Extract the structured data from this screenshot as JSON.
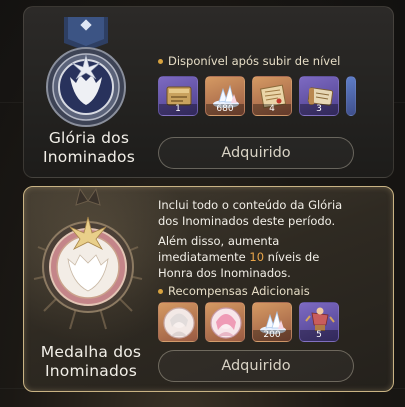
{
  "card1": {
    "name": "Glória dos\nInominados",
    "availability_text": "Disponível após subir de nível",
    "items": [
      {
        "icon": "scroll-box-icon",
        "qty": "1"
      },
      {
        "icon": "crystal-icon",
        "qty": "680"
      },
      {
        "icon": "map-scroll-icon",
        "qty": "4"
      },
      {
        "icon": "book-scroll-icon",
        "qty": "3"
      }
    ],
    "button_label": "Adquirido"
  },
  "card2": {
    "name": "Medalha dos\nInominados",
    "desc1_line1": "Inclui todo o conteúdo da Glória",
    "desc1_line2": "dos Inominados deste período.",
    "desc2_line1": "Além disso, aumenta",
    "desc2_line2_pre": "imediatamente ",
    "desc2_value": "10",
    "desc2_line2_post": " níveis de",
    "desc2_line3": "Honra dos Inominados.",
    "extra_rewards_label": "Recompensas Adicionais",
    "items": [
      {
        "icon": "character-portrait-white-icon",
        "qty": ""
      },
      {
        "icon": "character-portrait-pink-icon",
        "qty": ""
      },
      {
        "icon": "crystal-icon",
        "qty": "200"
      },
      {
        "icon": "trophy-figure-icon",
        "qty": "5"
      }
    ],
    "button_label": "Adquirido"
  },
  "colors": {
    "accent": "#e8a54a",
    "bullet": "#d8a33f",
    "card2_border": "#c9b384"
  }
}
